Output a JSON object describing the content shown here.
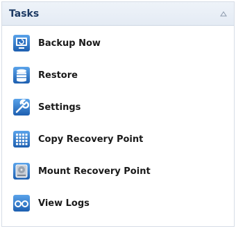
{
  "panel": {
    "title": "Tasks",
    "collapse_icon": "chevron-up-icon"
  },
  "tasks": [
    {
      "label": "Backup Now",
      "icon": "backup-monitor-icon"
    },
    {
      "label": "Restore",
      "icon": "restore-database-icon"
    },
    {
      "label": "Settings",
      "icon": "wrench-icon"
    },
    {
      "label": "Copy Recovery Point",
      "icon": "grid-copy-icon"
    },
    {
      "label": "Mount Recovery Point",
      "icon": "drive-mount-icon"
    },
    {
      "label": "View Logs",
      "icon": "glasses-icon"
    }
  ],
  "colors": {
    "header_bg": "#e6edf5",
    "title": "#1d3a63",
    "icon_blue": "#2f78c8"
  }
}
